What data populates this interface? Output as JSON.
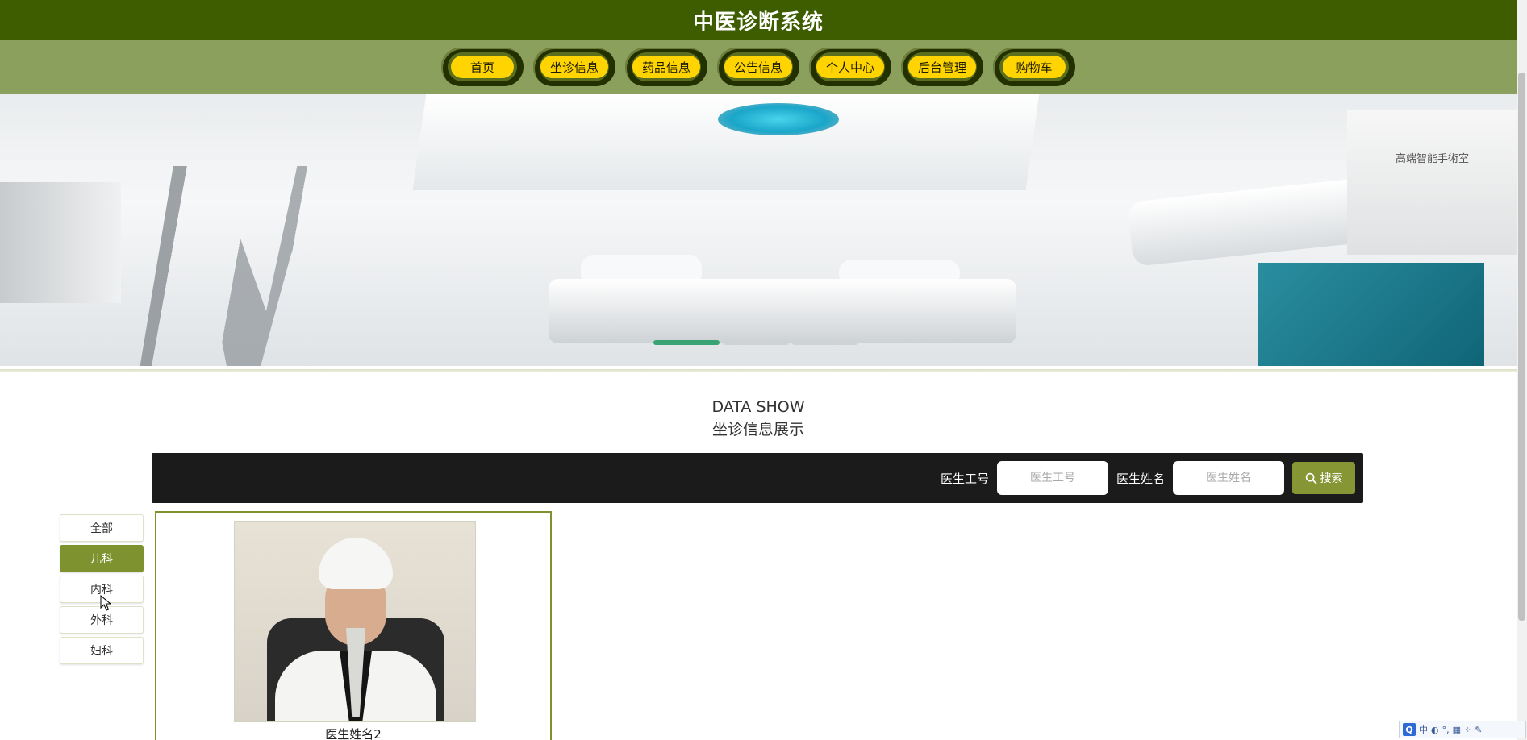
{
  "header": {
    "title": "中医诊断系统"
  },
  "nav": {
    "items": [
      {
        "label": "首页"
      },
      {
        "label": "坐诊信息"
      },
      {
        "label": "药品信息"
      },
      {
        "label": "公告信息"
      },
      {
        "label": "个人中心"
      },
      {
        "label": "后台管理"
      },
      {
        "label": "购物车"
      }
    ]
  },
  "banner": {
    "sign": "高端智能手術室",
    "slides": 3,
    "active_slide": 1
  },
  "section": {
    "title_en": "DATA SHOW",
    "title_cn": "坐诊信息展示"
  },
  "search": {
    "doctor_id_label": "医生工号",
    "doctor_id_placeholder": "医生工号",
    "doctor_name_label": "医生姓名",
    "doctor_name_placeholder": "医生姓名",
    "button_label": "搜索"
  },
  "categories": {
    "items": [
      {
        "label": "全部",
        "active": false
      },
      {
        "label": "儿科",
        "active": true
      },
      {
        "label": "内科",
        "active": false
      },
      {
        "label": "外科",
        "active": false
      },
      {
        "label": "妇科",
        "active": false
      }
    ]
  },
  "cards": [
    {
      "name": "医生姓名2"
    }
  ],
  "ime_tray": {
    "items": [
      "中",
      "◐",
      "°,",
      "▦",
      "⁘",
      "✎"
    ]
  },
  "colors": {
    "header_bg": "#3e5c00",
    "nav_bg": "#8aa05c",
    "nav_pill": "#ffd400",
    "accent": "#7e932f",
    "search_bar_bg": "#1b1b1b"
  }
}
